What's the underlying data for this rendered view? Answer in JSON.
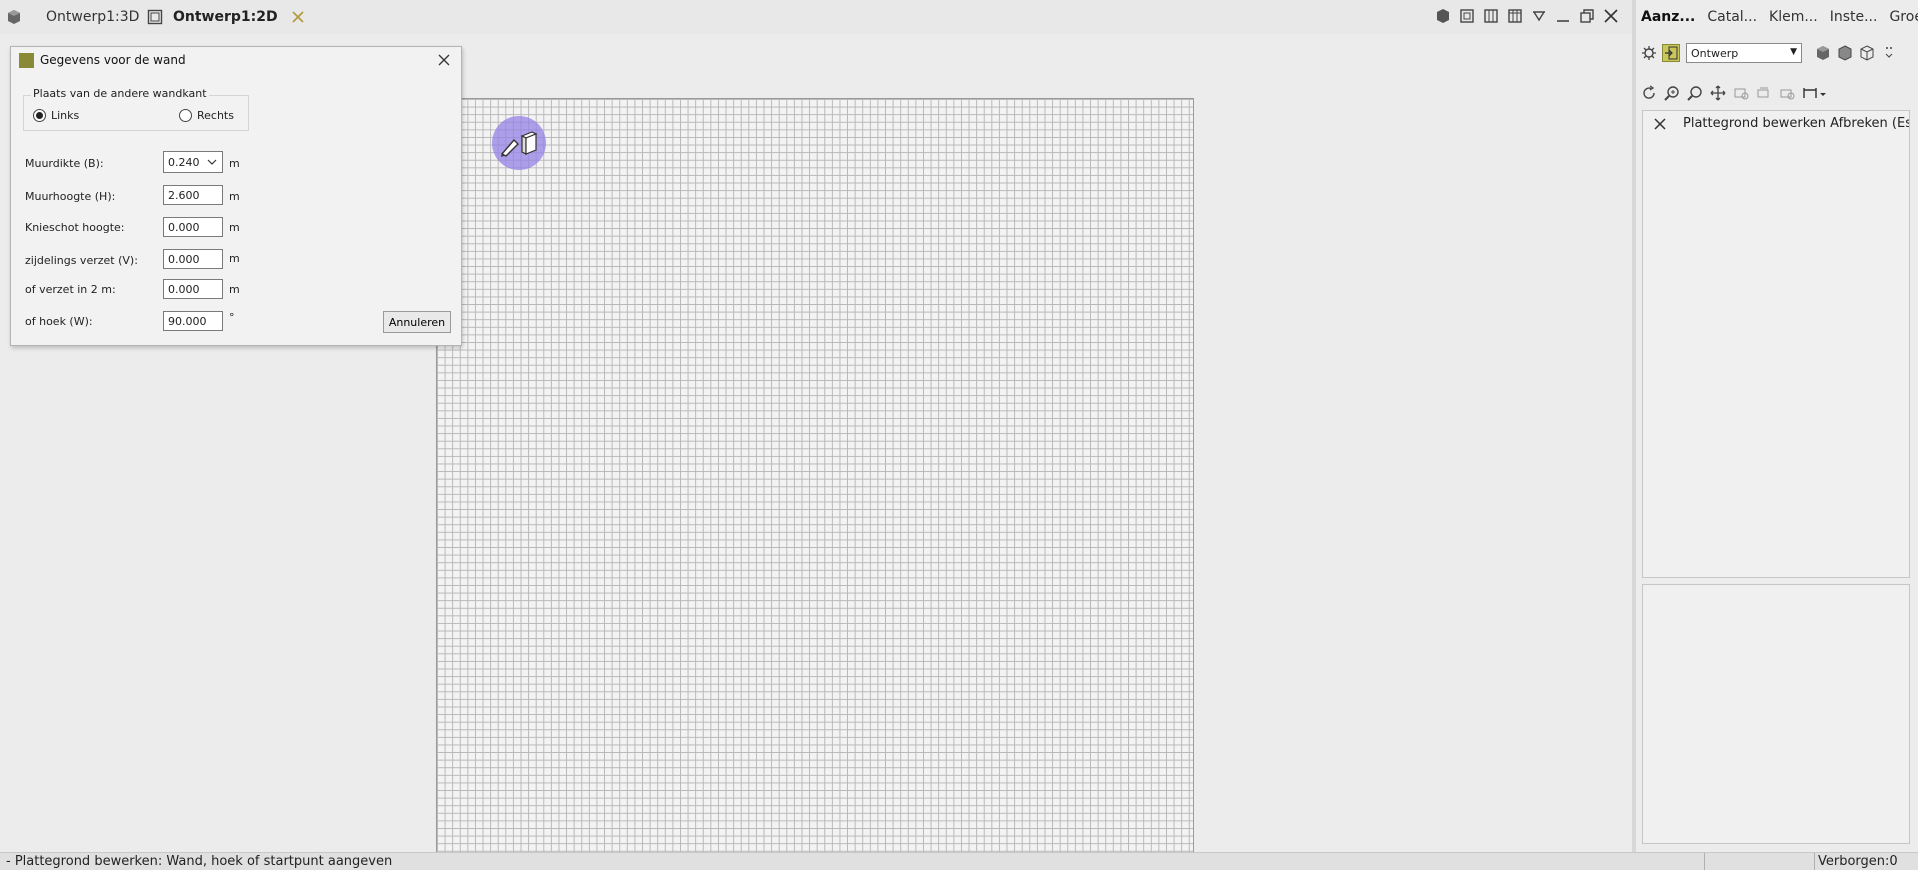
{
  "tabs": [
    {
      "label": "Ontwerp1:3D"
    },
    {
      "label": "Ontwerp1:2D"
    }
  ],
  "dialog": {
    "title": "Gegevens voor de wand",
    "group_label": "Plaats van de andere wandkant",
    "radio_links": "Links",
    "radio_rechts": "Rechts",
    "selected_side": "Links",
    "fields": [
      {
        "label": "Muurdikte (B):",
        "value": "0.240",
        "unit": "m",
        "type": "select"
      },
      {
        "label": "Muurhoogte (H):",
        "value": "2.600",
        "unit": "m",
        "type": "input"
      },
      {
        "label": "Knieschot hoogte:",
        "value": "0.000",
        "unit": "m",
        "type": "input"
      },
      {
        "label": "zijdelings verzet (V):",
        "value": "0.000",
        "unit": "m",
        "type": "input"
      },
      {
        "label": "of verzet in 2 m:",
        "value": "0.000",
        "unit": "m",
        "type": "input"
      },
      {
        "label": "of hoek (W):",
        "value": "90.000",
        "unit": "°",
        "type": "input"
      }
    ],
    "cancel_label": "Annuleren"
  },
  "panel": {
    "tabs": [
      "Aanz...",
      "Catal...",
      "Klem...",
      "Inste...",
      "Groe..."
    ],
    "mode_value": "Ontwerp",
    "info_text": "Plattegrond bewerken Afbreken (Esc"
  },
  "status": {
    "left": "- Plattegrond bewerken: Wand, hoek of startpunt aangeven",
    "right": "Verborgen:0"
  },
  "colors": {
    "accent": "#8a8a36",
    "cursor_badge": "#9682e6",
    "grid_line": "#b7b7b7"
  }
}
